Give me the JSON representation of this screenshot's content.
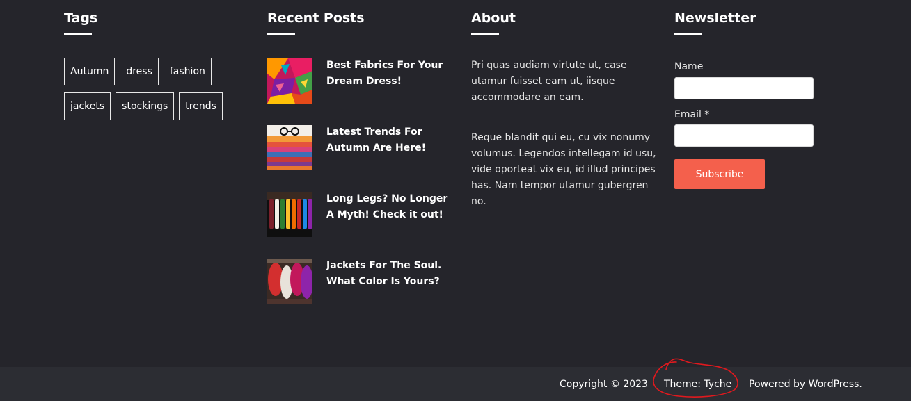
{
  "tags_widget": {
    "title": "Tags",
    "tags": [
      "Autumn",
      "dress",
      "fashion",
      "jackets",
      "stockings",
      "trends"
    ]
  },
  "recent_posts": {
    "title": "Recent Posts",
    "posts": [
      {
        "title": "Best Fabrics For Your Dream Dress!",
        "thumb": "colorful-fabrics-image"
      },
      {
        "title": "Latest Trends For Autumn Are Here!",
        "thumb": "folded-sweaters-glasses-image"
      },
      {
        "title": "Long Legs? No Longer A Myth! Check it out!",
        "thumb": "colored-stockings-image"
      },
      {
        "title": "Jackets For The Soul. What Color Is Yours?",
        "thumb": "jackets-rack-image"
      }
    ]
  },
  "about": {
    "title": "About",
    "paragraph1": "Pri quas audiam virtute ut, case utamur fuisset eam ut, iisque accommodare an eam.",
    "paragraph2": "Reque blandit qui eu, cu vix nonumy volumus. Legendos intellegam id usu, vide oporteat vix eu, id illud principes has. Nam tempor utamur gubergren no."
  },
  "newsletter": {
    "title": "Newsletter",
    "name_label": "Name",
    "name_value": "",
    "email_label": "Email *",
    "email_value": "",
    "subscribe_label": "Subscribe"
  },
  "bottom_bar": {
    "copyright": "Copyright © 2023",
    "theme": "Theme: Tyche",
    "powered": "Powered by WordPress."
  },
  "colors": {
    "background": "#25252b",
    "bottom_bar": "#2c2d33",
    "accent": "#f4604c",
    "annotation": "#e0191e"
  }
}
